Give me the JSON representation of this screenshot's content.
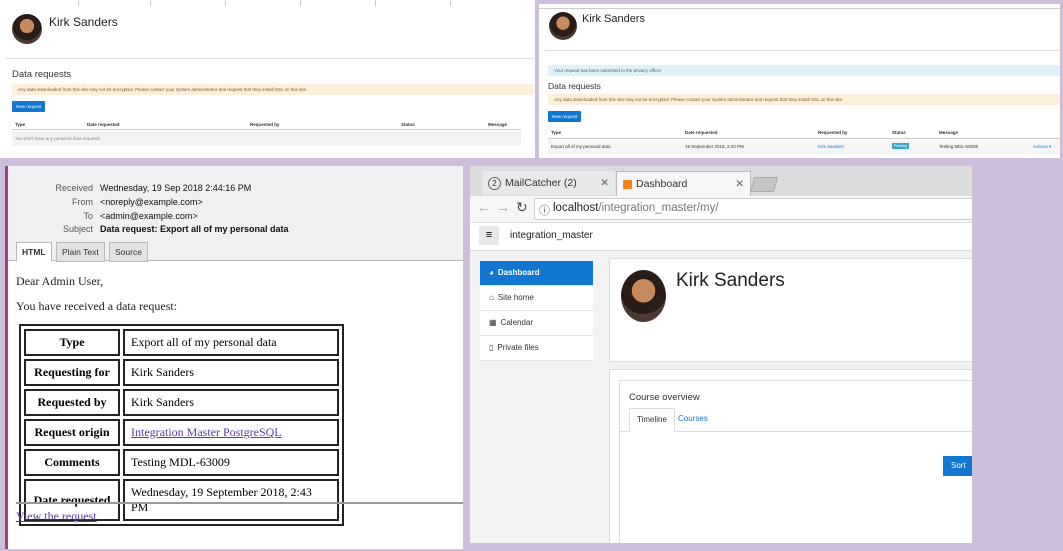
{
  "panel1": {
    "user_name": "Kirk Sanders",
    "section_title": "Data requests",
    "warning": "Any data downloaded from this site may not be encrypted. Please contact your system administrator and request that they install SSL on this site.",
    "new_request_label": "New request",
    "columns": [
      "Type",
      "Date requested",
      "Requested by",
      "Status",
      "Message"
    ],
    "empty_message": "You don't have any personal data requests."
  },
  "panel2": {
    "user_name": "Kirk Sanders",
    "info": "Your request has been submitted to the privacy officer",
    "section_title": "Data requests",
    "warning": "Any data downloaded from this site may not be encrypted. Please contact your system administrator and request that they install SSL on this site.",
    "new_request_label": "New request",
    "columns": [
      "Type",
      "Date requested",
      "Requested by",
      "Status",
      "Message"
    ],
    "row": {
      "type": "Export all of my personal data",
      "date": "19 September 2018, 2:43 PM",
      "requested_by": "Kirk Sanders",
      "status": "Pending",
      "message": "Testing MDL-63009",
      "actions": "Actions ▾"
    }
  },
  "email": {
    "received_label": "Received",
    "received": "Wednesday, 19 Sep 2018 2:44:16 PM",
    "from_label": "From",
    "from": "<noreply@example.com>",
    "to_label": "To",
    "to": "<admin@example.com>",
    "subject_label": "Subject",
    "subject": "Data request: Export all of my personal data",
    "tabs": [
      "HTML",
      "Plain Text",
      "Source"
    ],
    "greeting": "Dear Admin User,",
    "intro": "You have received a data request:",
    "table": [
      {
        "key": "Type",
        "value": "Export all of my personal data"
      },
      {
        "key": "Requesting for",
        "value": "Kirk Sanders"
      },
      {
        "key": "Requested by",
        "value": "Kirk Sanders"
      },
      {
        "key": "Request origin",
        "value": "Integration Master PostgreSQL"
      },
      {
        "key": "Comments",
        "value": "Testing MDL-63009"
      },
      {
        "key": "Date requested",
        "value": "Wednesday, 19 September 2018, 2:43 PM"
      }
    ],
    "view_link": "View the request"
  },
  "browser": {
    "tab1_count": "2",
    "tab1_title": "MailCatcher (2)",
    "tab2_title": "Dashboard",
    "url_host": "localhost",
    "url_path": "/integration_master/my/",
    "site_name": "integration_master",
    "nav": [
      "Dashboard",
      "Site home",
      "Calendar",
      "Private files"
    ],
    "user_name": "Kirk Sanders",
    "course_overview": "Course overview",
    "tabs": [
      "Timeline",
      "Courses"
    ],
    "sort_label": "Sort by"
  }
}
